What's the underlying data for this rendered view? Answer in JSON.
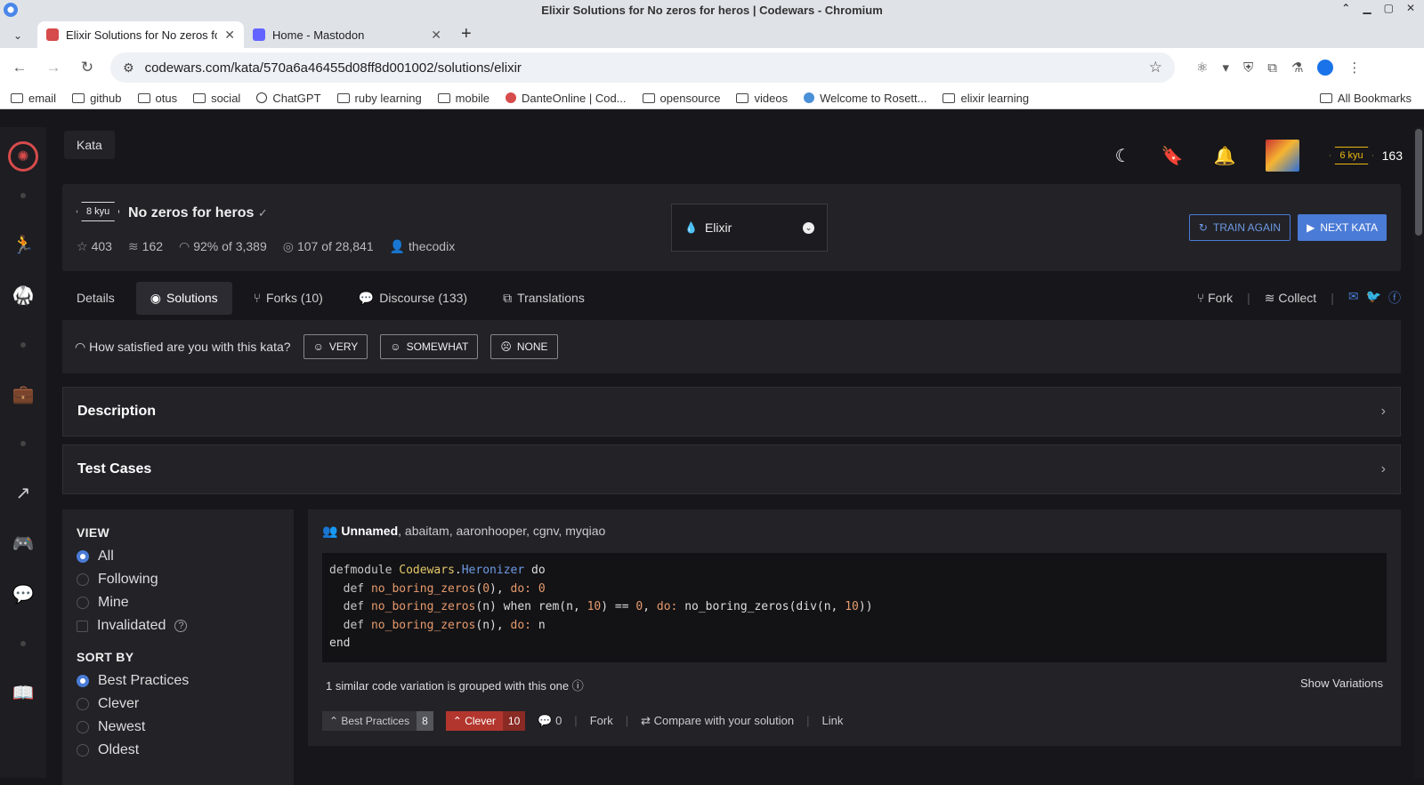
{
  "window": {
    "title": "Elixir Solutions for No zeros for heros | Codewars - Chromium"
  },
  "tabs": [
    {
      "title": "Elixir Solutions for No zeros fo",
      "fav_color": "#d64b4b"
    },
    {
      "title": "Home - Mastodon",
      "fav_color": "#6364ff"
    }
  ],
  "address": {
    "url": "codewars.com/kata/570a6a46455d08ff8d001002/solutions/elixir"
  },
  "bookmarks": [
    {
      "label": "email",
      "type": "folder"
    },
    {
      "label": "github",
      "type": "folder"
    },
    {
      "label": "otus",
      "type": "folder"
    },
    {
      "label": "social",
      "type": "folder"
    },
    {
      "label": "ChatGPT",
      "type": "site"
    },
    {
      "label": "ruby learning",
      "type": "folder"
    },
    {
      "label": "mobile",
      "type": "folder"
    },
    {
      "label": "DanteOnline | Cod...",
      "type": "site"
    },
    {
      "label": "opensource",
      "type": "folder"
    },
    {
      "label": "videos",
      "type": "folder"
    },
    {
      "label": "Welcome to Rosett...",
      "type": "site"
    },
    {
      "label": "elixir learning",
      "type": "folder"
    }
  ],
  "bookmarks_all": "All Bookmarks",
  "topbar": {
    "section": "Kata",
    "rank": "6 kyu",
    "honor": "163"
  },
  "kata": {
    "rank": "8 kyu",
    "title": "No zeros for heros",
    "stars": "403",
    "collections": "162",
    "satisfaction": "92% of 3,389",
    "completed": "107 of 28,841",
    "author": "thecodix",
    "language": "Elixir",
    "train_again": "TRAIN AGAIN",
    "next_kata": "NEXT KATA"
  },
  "page_tabs": [
    {
      "label": "Details",
      "icon": ""
    },
    {
      "label": "Solutions",
      "icon": "◉"
    },
    {
      "label": "Forks (10)",
      "icon": "⑂"
    },
    {
      "label": "Discourse (133)",
      "icon": "💬"
    },
    {
      "label": "Translations",
      "icon": "⧉"
    }
  ],
  "actions": {
    "fork": "Fork",
    "collect": "Collect"
  },
  "satisfaction": {
    "question": "How satisfied are you with this kata?",
    "options": [
      "VERY",
      "SOMEWHAT",
      "NONE"
    ]
  },
  "sections": {
    "description": "Description",
    "tests": "Test Cases"
  },
  "filters": {
    "view_label": "VIEW",
    "view_options": [
      "All",
      "Following",
      "Mine"
    ],
    "invalidated": "Invalidated",
    "sort_label": "SORT BY",
    "sort_options": [
      "Best Practices",
      "Clever",
      "Newest",
      "Oldest"
    ]
  },
  "solution": {
    "lead_author": "Unnamed",
    "other_authors": ", abaitam, aaronhooper, cgnv, myqiao",
    "variation_text": "1 similar code variation is grouped with this one",
    "show_variations": "Show Variations",
    "best_practices_label": "Best Practices",
    "best_practices_count": "8",
    "clever_label": "Clever",
    "clever_count": "10",
    "comments": "0",
    "fork": "Fork",
    "compare": "Compare with your solution",
    "link": "Link"
  }
}
